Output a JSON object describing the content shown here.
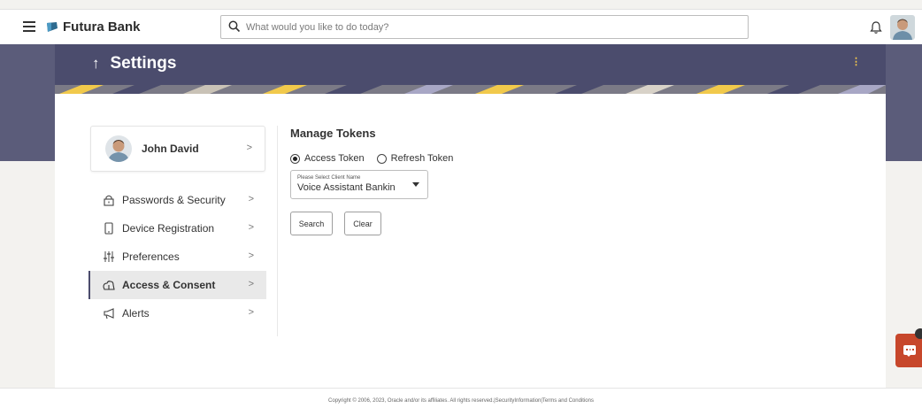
{
  "header": {
    "brand": "Futura Bank",
    "search_placeholder": "What would you like to do today?"
  },
  "page": {
    "title": "Settings",
    "back_icon": "up-arrow-icon"
  },
  "profile": {
    "name": "John David"
  },
  "menu": {
    "items": [
      {
        "label": "Passwords & Security",
        "icon": "lock-icon"
      },
      {
        "label": "Device Registration",
        "icon": "device-icon"
      },
      {
        "label": "Preferences",
        "icon": "sliders-icon"
      },
      {
        "label": "Access & Consent",
        "icon": "cloud-access-icon",
        "active": true
      },
      {
        "label": "Alerts",
        "icon": "megaphone-icon"
      }
    ]
  },
  "manage_tokens": {
    "title": "Manage Tokens",
    "radio_access": "Access Token",
    "radio_refresh": "Refresh Token",
    "selected_token": "Access Token",
    "select_label": "Please Select Client Name",
    "select_value": "Voice Assistant Bankin",
    "search_button": "Search",
    "clear_button": "Clear"
  },
  "footer": {
    "text": "Copyright © 2006, 2023, Oracle and/or its affiliates. All rights reserved.|SecurityInformation|Terms and Conditions"
  },
  "colors": {
    "hero": "#4b4c6d",
    "accent_kebab": "#f5c84a",
    "chat_fab": "#c7472b"
  }
}
